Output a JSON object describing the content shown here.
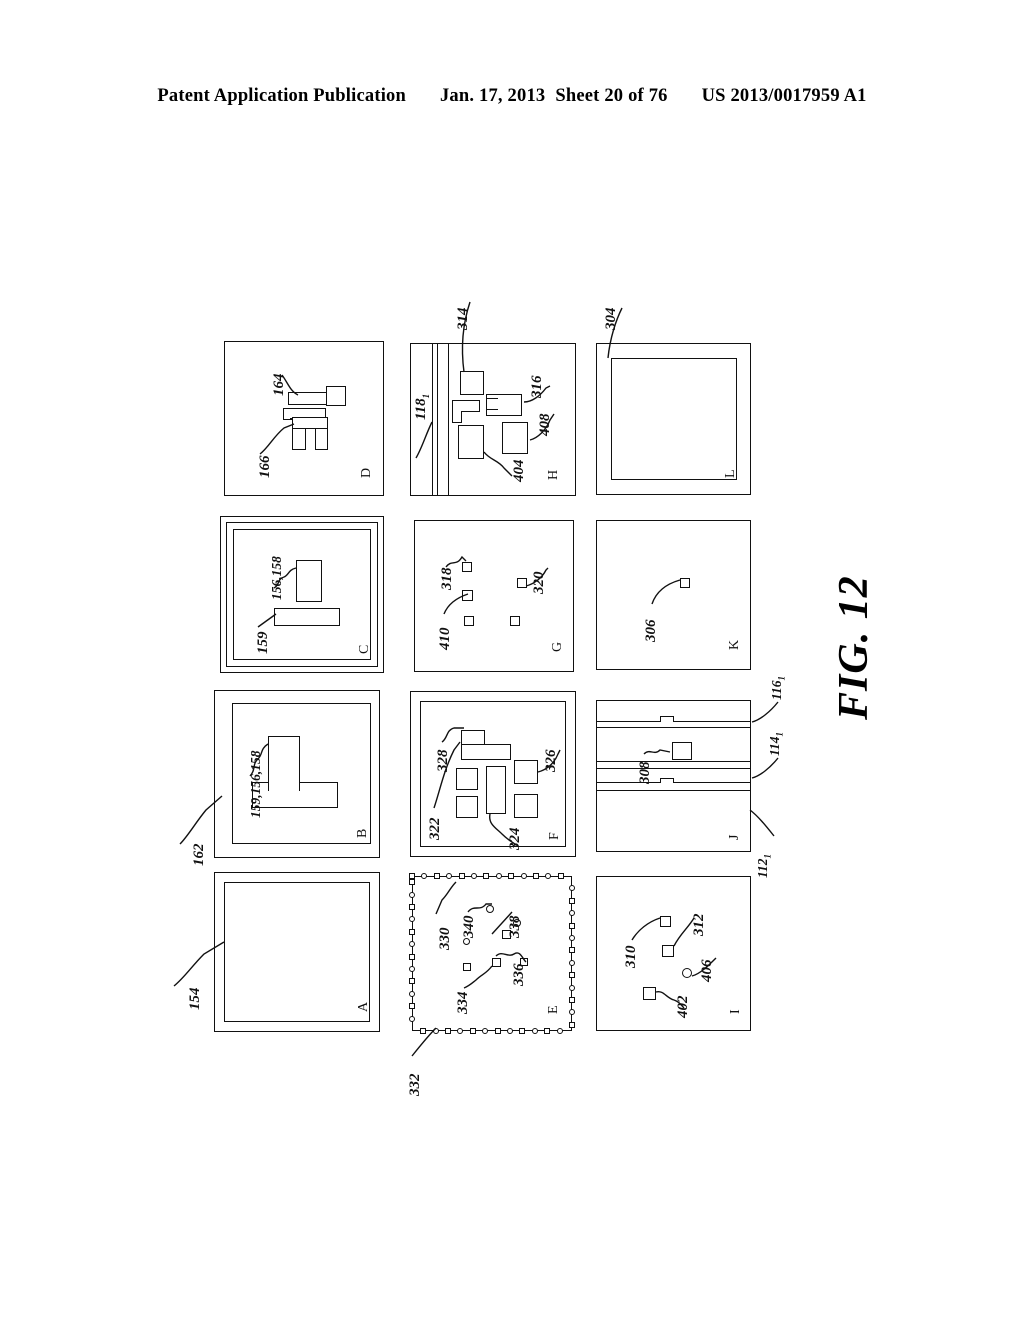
{
  "header": {
    "left": "Patent Application Publication",
    "date": "Jan. 17, 2013",
    "sheet": "Sheet 20 of 76",
    "pub_number": "US 2013/0017959 A1"
  },
  "figure": {
    "caption": "FIG. 12",
    "grid": {
      "rows": 3,
      "cols": 4
    }
  },
  "panels": [
    {
      "id": "A",
      "letter": "A",
      "refs": [
        "154"
      ]
    },
    {
      "id": "B",
      "letter": "B",
      "refs": [
        "159,156,158",
        "162"
      ]
    },
    {
      "id": "C",
      "letter": "C",
      "refs": [
        "156,158",
        "159"
      ]
    },
    {
      "id": "D",
      "letter": "D",
      "refs": [
        "164",
        "166"
      ]
    },
    {
      "id": "E",
      "letter": "E",
      "refs": [
        "330",
        "340",
        "338",
        "336",
        "334",
        "332"
      ]
    },
    {
      "id": "F",
      "letter": "F",
      "refs": [
        "328",
        "326",
        "322",
        "324"
      ]
    },
    {
      "id": "G",
      "letter": "G",
      "refs": [
        "318",
        "320",
        "410"
      ]
    },
    {
      "id": "H",
      "letter": "H",
      "refs": [
        "314",
        "118",
        "316",
        "408",
        "404"
      ]
    },
    {
      "id": "I",
      "letter": "I",
      "refs": [
        "310",
        "312",
        "406",
        "402"
      ]
    },
    {
      "id": "J",
      "letter": "J",
      "refs": [
        "308",
        "116",
        "114",
        "112"
      ]
    },
    {
      "id": "K",
      "letter": "K",
      "refs": [
        "306"
      ]
    },
    {
      "id": "L",
      "letter": "L",
      "refs": [
        "304"
      ]
    }
  ],
  "labels": {
    "r154": "154",
    "r162": "162",
    "r159_156_158": "159,156,158",
    "r156_158": "156,158",
    "r159": "159",
    "r164": "164",
    "r166": "166",
    "r330": "330",
    "r340": "340",
    "r338": "338",
    "r336": "336",
    "r334": "334",
    "r332": "332",
    "r328": "328",
    "r326": "326",
    "r322": "322",
    "r324": "324",
    "r318": "318",
    "r320": "320",
    "r410": "410",
    "r314": "314",
    "r118": "118",
    "r118_sub": "1",
    "r316": "316",
    "r408": "408",
    "r404": "404",
    "r310": "310",
    "r312": "312",
    "r406": "406",
    "r402": "402",
    "r308": "308",
    "r116": "116",
    "r116_sub": "1",
    "r114": "114",
    "r114_sub": "1",
    "r112": "112",
    "r112_sub": "1",
    "r306": "306",
    "r304": "304",
    "pA": "A",
    "pB": "B",
    "pC": "C",
    "pD": "D",
    "pE": "E",
    "pF": "F",
    "pG": "G",
    "pH": "H",
    "pI": "I",
    "pJ": "J",
    "pK": "K",
    "pL": "L"
  },
  "colors": {
    "ink": "#111111",
    "paper": "#ffffff"
  }
}
